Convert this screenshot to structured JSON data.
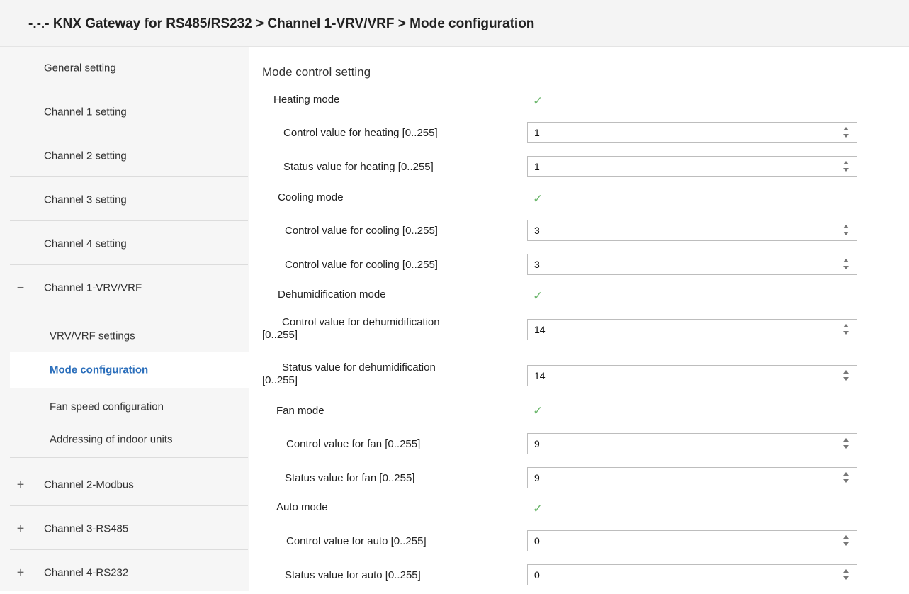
{
  "header": {
    "title": "-.-.- KNX Gateway for RS485/RS232 > Channel 1-VRV/VRF > Mode configuration"
  },
  "sidebar": {
    "items": [
      {
        "label": "General setting"
      },
      {
        "label": "Channel 1 setting"
      },
      {
        "label": "Channel 2 setting"
      },
      {
        "label": "Channel 3 setting"
      },
      {
        "label": "Channel 4 setting"
      },
      {
        "label": "Channel 1-VRV/VRF",
        "expander": "−"
      },
      {
        "label": "Channel 2-Modbus",
        "expander": "+"
      },
      {
        "label": "Channel 3-RS485",
        "expander": "+"
      },
      {
        "label": "Channel 4-RS232",
        "expander": "+"
      }
    ],
    "subitems": [
      {
        "label": "VRV/VRF settings"
      },
      {
        "label": "Mode configuration",
        "active": true
      },
      {
        "label": "Fan speed configuration"
      },
      {
        "label": "Addressing of indoor units"
      }
    ]
  },
  "main": {
    "section_title": "Mode control setting",
    "check_glyph": "✓",
    "rows": [
      {
        "type": "check",
        "label": "Heating mode",
        "checked": true
      },
      {
        "type": "spin",
        "label": "Control value for heating [0..255]",
        "value": "1"
      },
      {
        "type": "spin",
        "label": "Status value for heating [0..255]",
        "value": "1"
      },
      {
        "type": "check",
        "label": "Cooling mode",
        "checked": true
      },
      {
        "type": "spin",
        "label": "Control value for cooling [0..255]",
        "value": "3"
      },
      {
        "type": "spin",
        "label": "Control value for cooling [0..255]",
        "value": "3"
      },
      {
        "type": "check",
        "label": "Dehumidification mode",
        "checked": true
      },
      {
        "type": "spin",
        "label1": "Control value for dehumidification",
        "label2": "[0..255]",
        "value": "14"
      },
      {
        "type": "spin",
        "label1": "Status value for dehumidification",
        "label2": "[0..255]",
        "value": "14"
      },
      {
        "type": "check",
        "label": "Fan mode",
        "checked": true
      },
      {
        "type": "spin",
        "label": "Control value for fan [0..255]",
        "value": "9"
      },
      {
        "type": "spin",
        "label": "Status value for fan [0..255]",
        "value": "9"
      },
      {
        "type": "check",
        "label": "Auto mode",
        "checked": true
      },
      {
        "type": "spin",
        "label": "Control value for auto [0..255]",
        "value": "0"
      },
      {
        "type": "spin",
        "label": "Status value for auto [0..255]",
        "value": "0"
      }
    ]
  },
  "colors": {
    "accent": "#2a6ebb",
    "check": "#6fb86f"
  }
}
